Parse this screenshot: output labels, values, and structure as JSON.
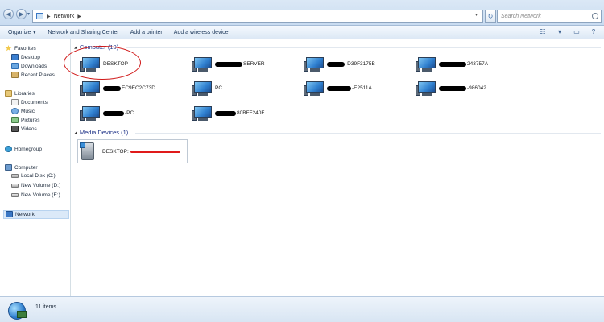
{
  "address": {
    "breadcrumb": [
      "Network"
    ],
    "search_placeholder": "Search Network"
  },
  "commands": {
    "organize": "Organize",
    "network_sharing": "Network and Sharing Center",
    "add_printer": "Add a printer",
    "add_wireless": "Add a wireless device"
  },
  "nav": {
    "favorites": "Favorites",
    "desktop": "Desktop",
    "downloads": "Downloads",
    "recent_places": "Recent Places",
    "libraries": "Libraries",
    "documents": "Documents",
    "music": "Music",
    "pictures": "Pictures",
    "videos": "Videos",
    "homegroup": "Homegroup",
    "computer": "Computer",
    "local_disk": "Local Disk (C:)",
    "new_volume_d": "New Volume (D:)",
    "new_volume_e": "New Volume (E:)",
    "network": "Network"
  },
  "groups": {
    "computer": "Computer (10)",
    "media": "Media Devices (1)"
  },
  "computers": [
    {
      "name": "DESKTOP",
      "redacted": false
    },
    {
      "name": "SERVER",
      "redacted": true
    },
    {
      "name": "-D39F3175B",
      "redacted": true
    },
    {
      "name": "243757A",
      "redacted": true
    },
    {
      "name": "EC9EC2C73D",
      "redacted": true
    },
    {
      "name": "PC",
      "redacted": false
    },
    {
      "name": "-E2511A",
      "redacted": true
    },
    {
      "name": "-986042",
      "redacted": true
    },
    {
      "name": "-PC",
      "redacted": true
    },
    {
      "name": "80BFF240F",
      "redacted": true
    }
  ],
  "media_device": {
    "name": "DESKTOP: "
  },
  "status": {
    "item_count": "11 items"
  }
}
